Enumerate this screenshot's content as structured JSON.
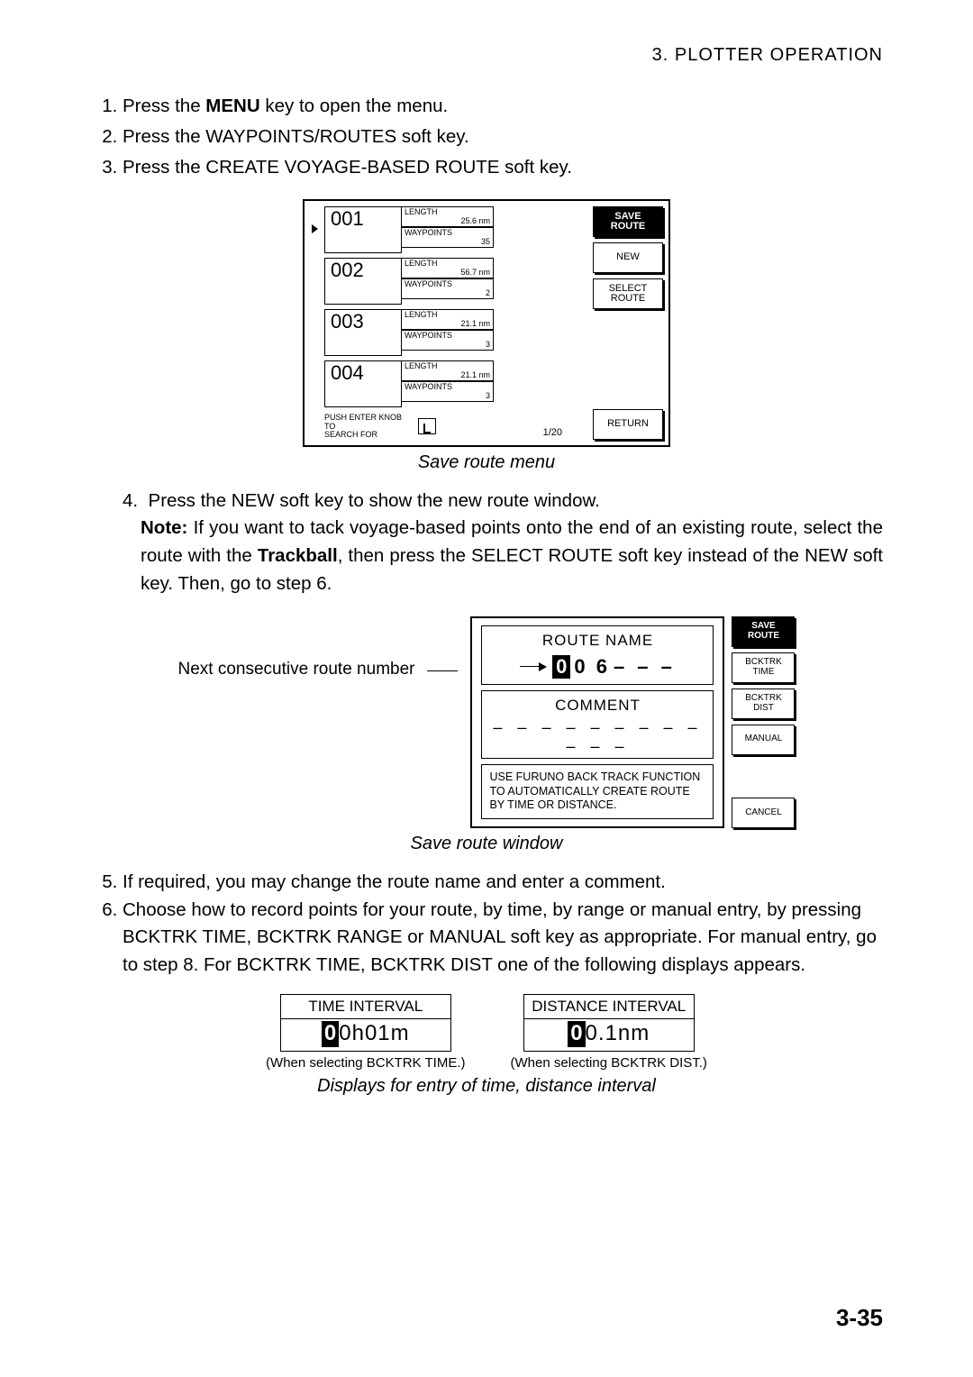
{
  "header": "3.  PLOTTER  OPERATION",
  "steps_a": [
    {
      "pre": "Press the ",
      "bold": "MENU",
      "post": " key to open the menu."
    },
    {
      "pre": "Press the WAYPOINTS/ROUTES soft key.",
      "bold": "",
      "post": ""
    },
    {
      "pre": "Press the CREATE VOYAGE-BASED ROUTE soft key.",
      "bold": "",
      "post": ""
    }
  ],
  "fig1": {
    "rows": [
      {
        "id": "001",
        "length_lbl": "LENGTH",
        "length_val": "25.6 nm",
        "wp_lbl": "WAYPOINTS",
        "wp_val": "35"
      },
      {
        "id": "002",
        "length_lbl": "LENGTH",
        "length_val": "56.7 nm",
        "wp_lbl": "WAYPOINTS",
        "wp_val": "2"
      },
      {
        "id": "003",
        "length_lbl": "LENGTH",
        "length_val": "21.1 nm",
        "wp_lbl": "WAYPOINTS",
        "wp_val": "3"
      },
      {
        "id": "004",
        "length_lbl": "LENGTH",
        "length_val": "21.1 nm",
        "wp_lbl": "WAYPOINTS",
        "wp_val": "3"
      }
    ],
    "pager": "1/20",
    "search_line1": "PUSH ENTER KNOB TO",
    "search_line2": "SEARCH FOR",
    "buttons": {
      "save1": "SAVE",
      "save2": "ROUTE",
      "new": "NEW",
      "sel1": "SELECT",
      "sel2": "ROUTE",
      "return": "RETURN"
    },
    "caption": "Save route menu"
  },
  "step4": {
    "num": "4.",
    "line1": "Press the NEW soft key to show the new route window.",
    "note_label": "Note:",
    "note_body_a": " If you want to tack voyage-based points onto the end of an existing route, select the route with the ",
    "note_bold": "Trackball",
    "note_body_b": ", then press the SELECT ROUTE soft key instead of the NEW soft key. Then, go to step 6."
  },
  "fig2": {
    "lead": "Next consecutive route number",
    "route_label": "ROUTE NAME",
    "route_first": "0",
    "route_rest": " 0 6",
    "route_dashes": "– – –",
    "comment_label": "COMMENT",
    "comment_dashes": "– – – – – – – – – – – –",
    "hint_l1": "USE FURUNO BACK TRACK FUNCTION",
    "hint_l2": "TO AUTOMATICALLY CREATE ROUTE",
    "hint_l3": "BY TIME OR DISTANCE.",
    "buttons": {
      "save1": "SAVE",
      "save2": "ROUTE",
      "bt1a": "BCKTRK",
      "bt1b": "TIME",
      "bt2a": "BCKTRK",
      "bt2b": "DIST",
      "manual": "MANUAL",
      "cancel": "CANCEL"
    },
    "caption": "Save route window"
  },
  "steps_b": [
    "If required, you may change the route name and enter a comment.",
    "Choose how to record points for your route, by time, by range or manual entry, by pressing BCKTRK TIME, BCKTRK RANGE or MANUAL soft key as appropriate. For manual entry, go to step 8. For BCKTRK TIME, BCKTRK DIST one of the following displays appears."
  ],
  "fig3": {
    "left": {
      "title": "TIME INTERVAL",
      "first": "0",
      "rest": "0h01m",
      "sub": "(When selecting BCKTRK TIME.)"
    },
    "right": {
      "title": "DISTANCE INTERVAL",
      "first": "0",
      "rest": "0.1nm",
      "sub": "(When selecting BCKTRK DIST.)"
    },
    "caption": "Displays for entry of time, distance interval"
  },
  "page_num": "3-35"
}
